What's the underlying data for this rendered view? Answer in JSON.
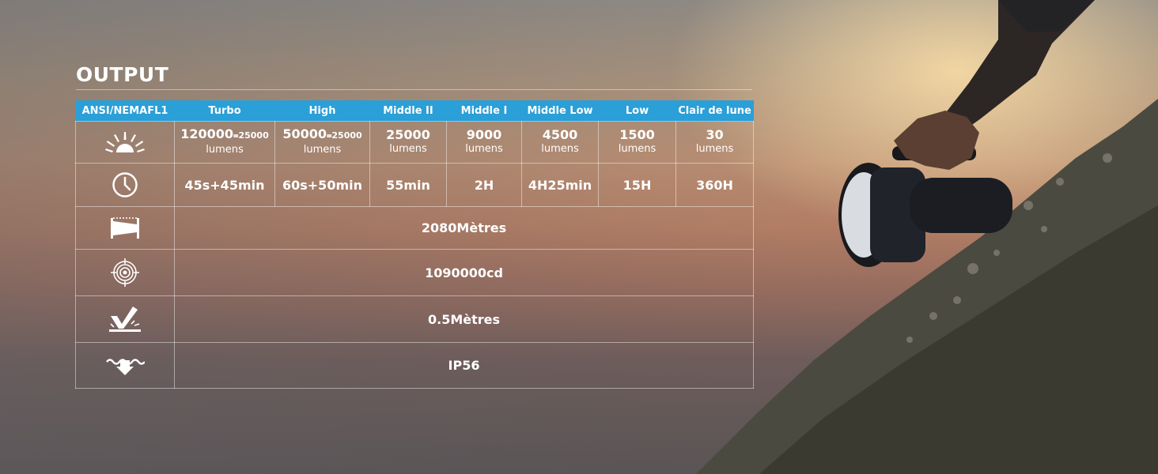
{
  "title": "OUTPUT",
  "columns": [
    "ANSI/NEMAFL1",
    "Turbo",
    "High",
    "Middle II",
    "Middle I",
    "Middle Low",
    "Low",
    "Clair de lune"
  ],
  "lumens": [
    {
      "value": "120000",
      "note": "᐀25000",
      "unit": "lumens"
    },
    {
      "value": "50000",
      "note": "᐀25000",
      "unit": "lumens"
    },
    {
      "value": "25000",
      "unit": "lumens"
    },
    {
      "value": "9000",
      "unit": "lumens"
    },
    {
      "value": "4500",
      "unit": "lumens"
    },
    {
      "value": "1500",
      "unit": "lumens"
    },
    {
      "value": "30",
      "unit": "lumens"
    }
  ],
  "runtimes": [
    "45s+45min",
    "60s+50min",
    "55min",
    "2H",
    "4H25min",
    "15H",
    "360H"
  ],
  "beam_distance": "2080Mètres",
  "peak_intensity": "1090000cd",
  "impact_resistance": "0.5Mètres",
  "water_rating": "IP56",
  "icons": [
    "sun-burst-icon",
    "clock-icon",
    "beam-distance-icon",
    "target-intensity-icon",
    "impact-resistance-icon",
    "water-resistance-icon"
  ],
  "colors": {
    "header_blue": "#2a9fd8"
  }
}
